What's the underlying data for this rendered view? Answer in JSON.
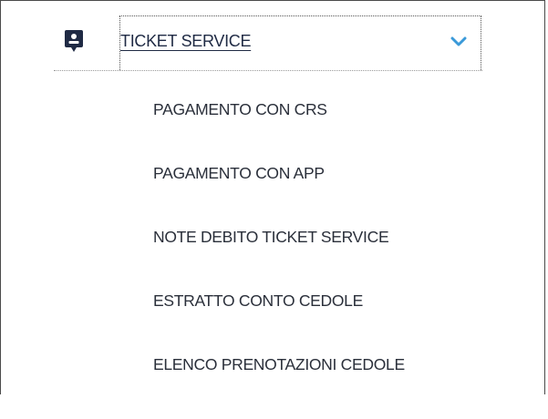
{
  "menu": {
    "header": {
      "label": "TICKET SERVICE",
      "icon": "ticket-badge-icon",
      "expanded_icon": "chevron-down-icon",
      "icon_color": "#1f2a44",
      "chevron_color": "#3b9ad9"
    },
    "items": [
      {
        "label": "PAGAMENTO CON CRS"
      },
      {
        "label": "PAGAMENTO CON APP"
      },
      {
        "label": "NOTE DEBITO TICKET SERVICE"
      },
      {
        "label": "ESTRATTO CONTO CEDOLE"
      },
      {
        "label": "ELENCO PRENOTAZIONI CEDOLE"
      }
    ]
  }
}
